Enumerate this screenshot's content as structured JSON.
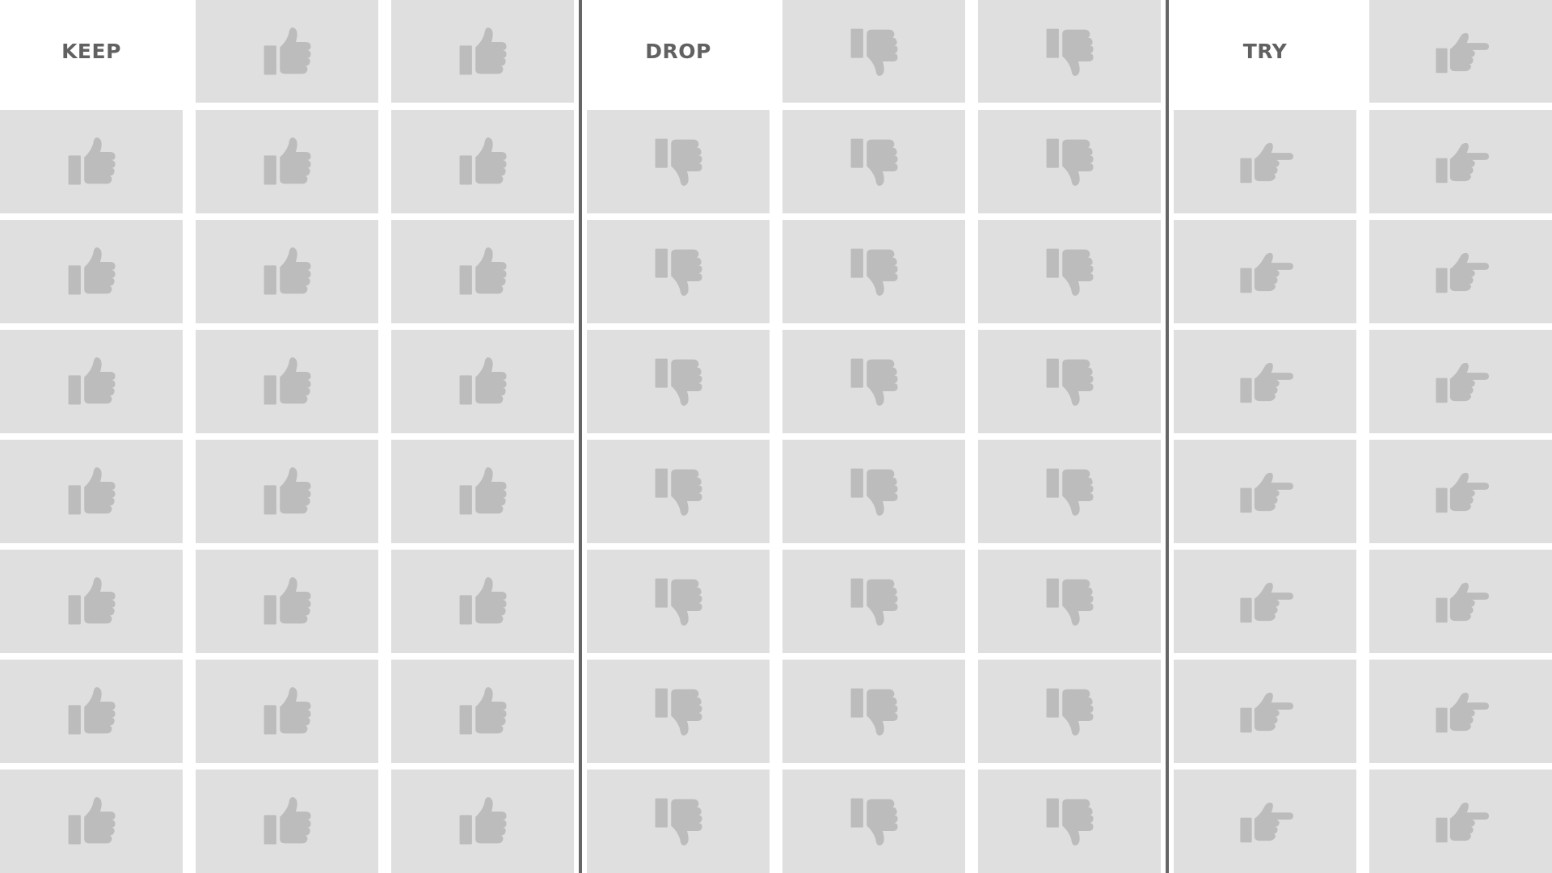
{
  "board": {
    "sections": [
      {
        "key": "keep",
        "label": "KEEP",
        "icon": "thumbs-up-icon",
        "columns": 3
      },
      {
        "key": "drop",
        "label": "DROP",
        "icon": "thumbs-down-icon",
        "columns": 3
      },
      {
        "key": "try",
        "label": "TRY",
        "icon": "pointing-hand-icon",
        "columns": 2
      }
    ],
    "rows": 8
  },
  "colors": {
    "card": "#dfdfdf",
    "icon": "#bcbcbc",
    "header_text": "#616161",
    "divider": "#666666",
    "background": "#ffffff"
  }
}
